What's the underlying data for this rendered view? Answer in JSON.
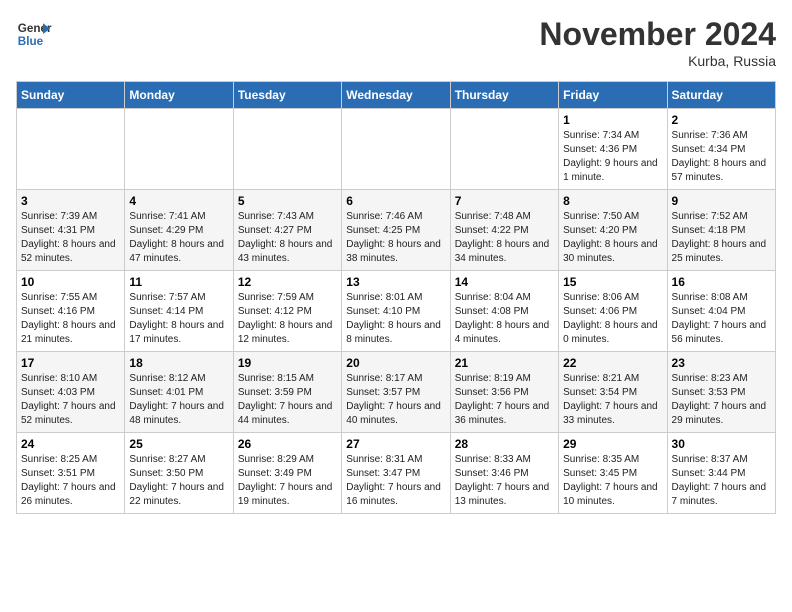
{
  "logo": {
    "line1": "General",
    "line2": "Blue"
  },
  "title": "November 2024",
  "location": "Kurba, Russia",
  "header": {
    "days": [
      "Sunday",
      "Monday",
      "Tuesday",
      "Wednesday",
      "Thursday",
      "Friday",
      "Saturday"
    ]
  },
  "weeks": [
    [
      {
        "day": "",
        "info": ""
      },
      {
        "day": "",
        "info": ""
      },
      {
        "day": "",
        "info": ""
      },
      {
        "day": "",
        "info": ""
      },
      {
        "day": "",
        "info": ""
      },
      {
        "day": "1",
        "info": "Sunrise: 7:34 AM\nSunset: 4:36 PM\nDaylight: 9 hours and 1 minute."
      },
      {
        "day": "2",
        "info": "Sunrise: 7:36 AM\nSunset: 4:34 PM\nDaylight: 8 hours and 57 minutes."
      }
    ],
    [
      {
        "day": "3",
        "info": "Sunrise: 7:39 AM\nSunset: 4:31 PM\nDaylight: 8 hours and 52 minutes."
      },
      {
        "day": "4",
        "info": "Sunrise: 7:41 AM\nSunset: 4:29 PM\nDaylight: 8 hours and 47 minutes."
      },
      {
        "day": "5",
        "info": "Sunrise: 7:43 AM\nSunset: 4:27 PM\nDaylight: 8 hours and 43 minutes."
      },
      {
        "day": "6",
        "info": "Sunrise: 7:46 AM\nSunset: 4:25 PM\nDaylight: 8 hours and 38 minutes."
      },
      {
        "day": "7",
        "info": "Sunrise: 7:48 AM\nSunset: 4:22 PM\nDaylight: 8 hours and 34 minutes."
      },
      {
        "day": "8",
        "info": "Sunrise: 7:50 AM\nSunset: 4:20 PM\nDaylight: 8 hours and 30 minutes."
      },
      {
        "day": "9",
        "info": "Sunrise: 7:52 AM\nSunset: 4:18 PM\nDaylight: 8 hours and 25 minutes."
      }
    ],
    [
      {
        "day": "10",
        "info": "Sunrise: 7:55 AM\nSunset: 4:16 PM\nDaylight: 8 hours and 21 minutes."
      },
      {
        "day": "11",
        "info": "Sunrise: 7:57 AM\nSunset: 4:14 PM\nDaylight: 8 hours and 17 minutes."
      },
      {
        "day": "12",
        "info": "Sunrise: 7:59 AM\nSunset: 4:12 PM\nDaylight: 8 hours and 12 minutes."
      },
      {
        "day": "13",
        "info": "Sunrise: 8:01 AM\nSunset: 4:10 PM\nDaylight: 8 hours and 8 minutes."
      },
      {
        "day": "14",
        "info": "Sunrise: 8:04 AM\nSunset: 4:08 PM\nDaylight: 8 hours and 4 minutes."
      },
      {
        "day": "15",
        "info": "Sunrise: 8:06 AM\nSunset: 4:06 PM\nDaylight: 8 hours and 0 minutes."
      },
      {
        "day": "16",
        "info": "Sunrise: 8:08 AM\nSunset: 4:04 PM\nDaylight: 7 hours and 56 minutes."
      }
    ],
    [
      {
        "day": "17",
        "info": "Sunrise: 8:10 AM\nSunset: 4:03 PM\nDaylight: 7 hours and 52 minutes."
      },
      {
        "day": "18",
        "info": "Sunrise: 8:12 AM\nSunset: 4:01 PM\nDaylight: 7 hours and 48 minutes."
      },
      {
        "day": "19",
        "info": "Sunrise: 8:15 AM\nSunset: 3:59 PM\nDaylight: 7 hours and 44 minutes."
      },
      {
        "day": "20",
        "info": "Sunrise: 8:17 AM\nSunset: 3:57 PM\nDaylight: 7 hours and 40 minutes."
      },
      {
        "day": "21",
        "info": "Sunrise: 8:19 AM\nSunset: 3:56 PM\nDaylight: 7 hours and 36 minutes."
      },
      {
        "day": "22",
        "info": "Sunrise: 8:21 AM\nSunset: 3:54 PM\nDaylight: 7 hours and 33 minutes."
      },
      {
        "day": "23",
        "info": "Sunrise: 8:23 AM\nSunset: 3:53 PM\nDaylight: 7 hours and 29 minutes."
      }
    ],
    [
      {
        "day": "24",
        "info": "Sunrise: 8:25 AM\nSunset: 3:51 PM\nDaylight: 7 hours and 26 minutes."
      },
      {
        "day": "25",
        "info": "Sunrise: 8:27 AM\nSunset: 3:50 PM\nDaylight: 7 hours and 22 minutes."
      },
      {
        "day": "26",
        "info": "Sunrise: 8:29 AM\nSunset: 3:49 PM\nDaylight: 7 hours and 19 minutes."
      },
      {
        "day": "27",
        "info": "Sunrise: 8:31 AM\nSunset: 3:47 PM\nDaylight: 7 hours and 16 minutes."
      },
      {
        "day": "28",
        "info": "Sunrise: 8:33 AM\nSunset: 3:46 PM\nDaylight: 7 hours and 13 minutes."
      },
      {
        "day": "29",
        "info": "Sunrise: 8:35 AM\nSunset: 3:45 PM\nDaylight: 7 hours and 10 minutes."
      },
      {
        "day": "30",
        "info": "Sunrise: 8:37 AM\nSunset: 3:44 PM\nDaylight: 7 hours and 7 minutes."
      }
    ]
  ]
}
